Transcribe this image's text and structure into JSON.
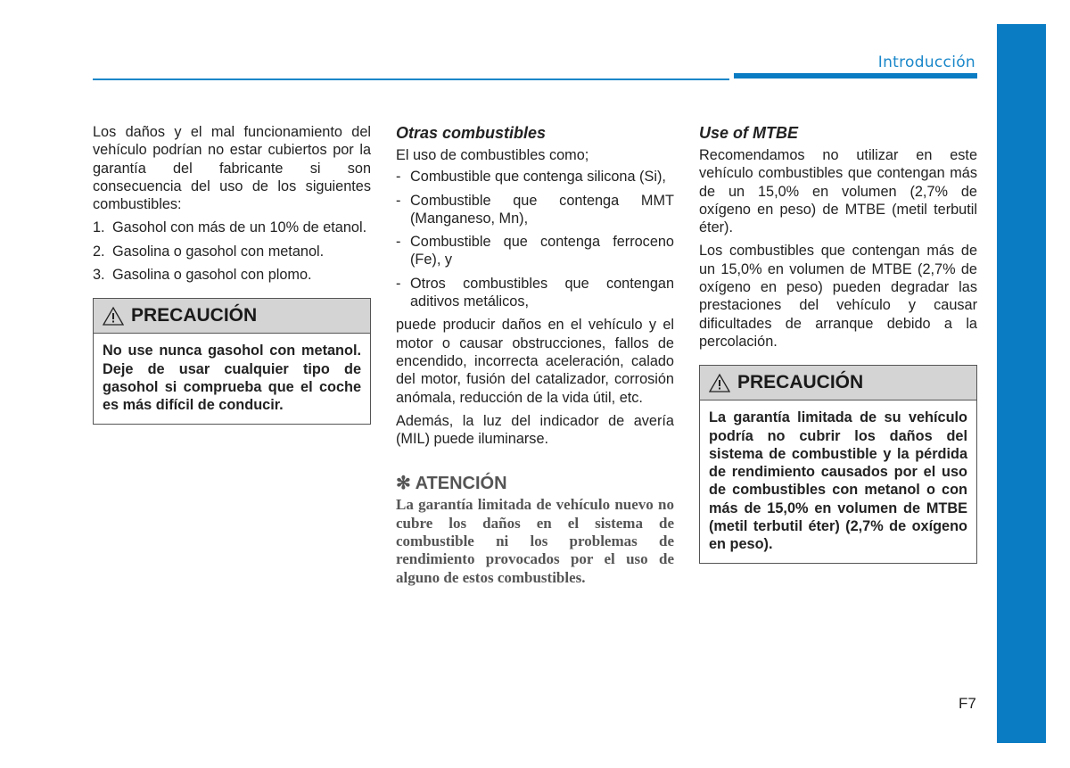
{
  "header": {
    "section_title": "Introducción"
  },
  "colors": {
    "accent_blue": "#0a7cc4",
    "caution_header_bg": "#d4d4d4"
  },
  "column1": {
    "intro": "Los daños y el mal funcionamiento del vehículo podrían no estar cubiertos por la garantía del fabricante si son consecuencia del uso de los siguientes combustibles:",
    "list": [
      {
        "marker": "1.",
        "text": "Gasohol con más de un 10% de etanol."
      },
      {
        "marker": "2.",
        "text": "Gasolina o gasohol con metanol."
      },
      {
        "marker": "3.",
        "text": "Gasolina o gasohol con plomo."
      }
    ],
    "caution": {
      "icon": "warning-triangle-icon",
      "title": "PRECAUCIÓN",
      "body": "No use nunca gasohol con metanol. Deje de usar cualquier tipo de gasohol si comprueba que el coche es más difícil de conducir."
    }
  },
  "column2": {
    "heading": "Otras combustibles",
    "intro": "El uso de combustibles como;",
    "list": [
      {
        "marker": "-",
        "text": "Combustible que contenga silicona (Si),"
      },
      {
        "marker": "-",
        "text": "Combustible que contenga MMT (Manganeso, Mn),"
      },
      {
        "marker": "-",
        "text": "Combustible que contenga ferroceno (Fe), y"
      },
      {
        "marker": "-",
        "text": "Otros combustibles que contengan aditivos metálicos,"
      }
    ],
    "paragraph1": "puede producir daños en el vehículo y el motor o causar obstrucciones, fallos de encendido, incorrecta aceleración, calado del motor, fusión del catalizador, corrosión anómala, reducción de la vida útil, etc.",
    "paragraph2": "Además, la luz del indicador de avería (MIL) puede iluminarse.",
    "attention": {
      "icon": "asterisk-icon",
      "symbol": "✻",
      "title": "ATENCIÓN",
      "body": "La garantía limitada de vehículo nuevo no cubre los daños en el sistema de combustible ni los problemas de rendimiento provocados por el uso de alguno de estos combustibles."
    }
  },
  "column3": {
    "heading": "Use of MTBE",
    "paragraph1": "Recomendamos no utilizar en este vehículo combustibles que contengan más de un 15,0% en volumen (2,7% de oxígeno en peso) de MTBE (metil terbutil éter).",
    "paragraph2": "Los combustibles que contengan más de un 15,0% en volumen de MTBE (2,7% de oxígeno en peso) pueden degradar las prestaciones del vehículo y causar dificultades de arranque debido a la percolación.",
    "caution": {
      "icon": "warning-triangle-icon",
      "title": "PRECAUCIÓN",
      "body": "La garantía limitada de su vehículo podría no cubrir los daños del sistema de combustible y la pérdida de rendimiento causados por el uso de combustibles con metanol o con más de 15,0% en volumen de MTBE (metil terbutil éter) (2,7% de oxígeno en peso)."
    }
  },
  "footer": {
    "page_number": "F7"
  }
}
